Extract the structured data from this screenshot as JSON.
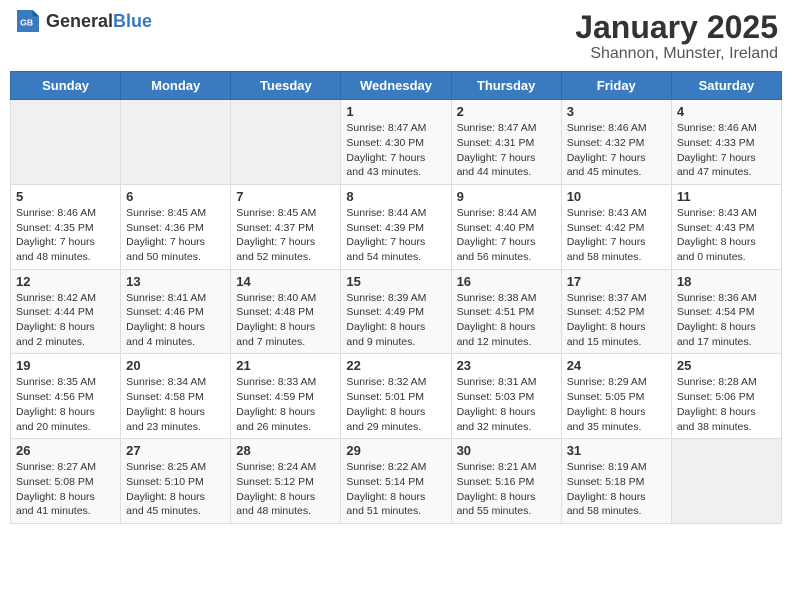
{
  "header": {
    "logo": {
      "text_general": "General",
      "text_blue": "Blue"
    },
    "title": "January 2025",
    "subtitle": "Shannon, Munster, Ireland"
  },
  "days_of_week": [
    "Sunday",
    "Monday",
    "Tuesday",
    "Wednesday",
    "Thursday",
    "Friday",
    "Saturday"
  ],
  "weeks": [
    [
      {
        "day": null,
        "content": null
      },
      {
        "day": null,
        "content": null
      },
      {
        "day": null,
        "content": null
      },
      {
        "day": 1,
        "content": "Sunrise: 8:47 AM\nSunset: 4:30 PM\nDaylight: 7 hours\nand 43 minutes."
      },
      {
        "day": 2,
        "content": "Sunrise: 8:47 AM\nSunset: 4:31 PM\nDaylight: 7 hours\nand 44 minutes."
      },
      {
        "day": 3,
        "content": "Sunrise: 8:46 AM\nSunset: 4:32 PM\nDaylight: 7 hours\nand 45 minutes."
      },
      {
        "day": 4,
        "content": "Sunrise: 8:46 AM\nSunset: 4:33 PM\nDaylight: 7 hours\nand 47 minutes."
      }
    ],
    [
      {
        "day": 5,
        "content": "Sunrise: 8:46 AM\nSunset: 4:35 PM\nDaylight: 7 hours\nand 48 minutes."
      },
      {
        "day": 6,
        "content": "Sunrise: 8:45 AM\nSunset: 4:36 PM\nDaylight: 7 hours\nand 50 minutes."
      },
      {
        "day": 7,
        "content": "Sunrise: 8:45 AM\nSunset: 4:37 PM\nDaylight: 7 hours\nand 52 minutes."
      },
      {
        "day": 8,
        "content": "Sunrise: 8:44 AM\nSunset: 4:39 PM\nDaylight: 7 hours\nand 54 minutes."
      },
      {
        "day": 9,
        "content": "Sunrise: 8:44 AM\nSunset: 4:40 PM\nDaylight: 7 hours\nand 56 minutes."
      },
      {
        "day": 10,
        "content": "Sunrise: 8:43 AM\nSunset: 4:42 PM\nDaylight: 7 hours\nand 58 minutes."
      },
      {
        "day": 11,
        "content": "Sunrise: 8:43 AM\nSunset: 4:43 PM\nDaylight: 8 hours\nand 0 minutes."
      }
    ],
    [
      {
        "day": 12,
        "content": "Sunrise: 8:42 AM\nSunset: 4:44 PM\nDaylight: 8 hours\nand 2 minutes."
      },
      {
        "day": 13,
        "content": "Sunrise: 8:41 AM\nSunset: 4:46 PM\nDaylight: 8 hours\nand 4 minutes."
      },
      {
        "day": 14,
        "content": "Sunrise: 8:40 AM\nSunset: 4:48 PM\nDaylight: 8 hours\nand 7 minutes."
      },
      {
        "day": 15,
        "content": "Sunrise: 8:39 AM\nSunset: 4:49 PM\nDaylight: 8 hours\nand 9 minutes."
      },
      {
        "day": 16,
        "content": "Sunrise: 8:38 AM\nSunset: 4:51 PM\nDaylight: 8 hours\nand 12 minutes."
      },
      {
        "day": 17,
        "content": "Sunrise: 8:37 AM\nSunset: 4:52 PM\nDaylight: 8 hours\nand 15 minutes."
      },
      {
        "day": 18,
        "content": "Sunrise: 8:36 AM\nSunset: 4:54 PM\nDaylight: 8 hours\nand 17 minutes."
      }
    ],
    [
      {
        "day": 19,
        "content": "Sunrise: 8:35 AM\nSunset: 4:56 PM\nDaylight: 8 hours\nand 20 minutes."
      },
      {
        "day": 20,
        "content": "Sunrise: 8:34 AM\nSunset: 4:58 PM\nDaylight: 8 hours\nand 23 minutes."
      },
      {
        "day": 21,
        "content": "Sunrise: 8:33 AM\nSunset: 4:59 PM\nDaylight: 8 hours\nand 26 minutes."
      },
      {
        "day": 22,
        "content": "Sunrise: 8:32 AM\nSunset: 5:01 PM\nDaylight: 8 hours\nand 29 minutes."
      },
      {
        "day": 23,
        "content": "Sunrise: 8:31 AM\nSunset: 5:03 PM\nDaylight: 8 hours\nand 32 minutes."
      },
      {
        "day": 24,
        "content": "Sunrise: 8:29 AM\nSunset: 5:05 PM\nDaylight: 8 hours\nand 35 minutes."
      },
      {
        "day": 25,
        "content": "Sunrise: 8:28 AM\nSunset: 5:06 PM\nDaylight: 8 hours\nand 38 minutes."
      }
    ],
    [
      {
        "day": 26,
        "content": "Sunrise: 8:27 AM\nSunset: 5:08 PM\nDaylight: 8 hours\nand 41 minutes."
      },
      {
        "day": 27,
        "content": "Sunrise: 8:25 AM\nSunset: 5:10 PM\nDaylight: 8 hours\nand 45 minutes."
      },
      {
        "day": 28,
        "content": "Sunrise: 8:24 AM\nSunset: 5:12 PM\nDaylight: 8 hours\nand 48 minutes."
      },
      {
        "day": 29,
        "content": "Sunrise: 8:22 AM\nSunset: 5:14 PM\nDaylight: 8 hours\nand 51 minutes."
      },
      {
        "day": 30,
        "content": "Sunrise: 8:21 AM\nSunset: 5:16 PM\nDaylight: 8 hours\nand 55 minutes."
      },
      {
        "day": 31,
        "content": "Sunrise: 8:19 AM\nSunset: 5:18 PM\nDaylight: 8 hours\nand 58 minutes."
      },
      {
        "day": null,
        "content": null
      }
    ]
  ]
}
